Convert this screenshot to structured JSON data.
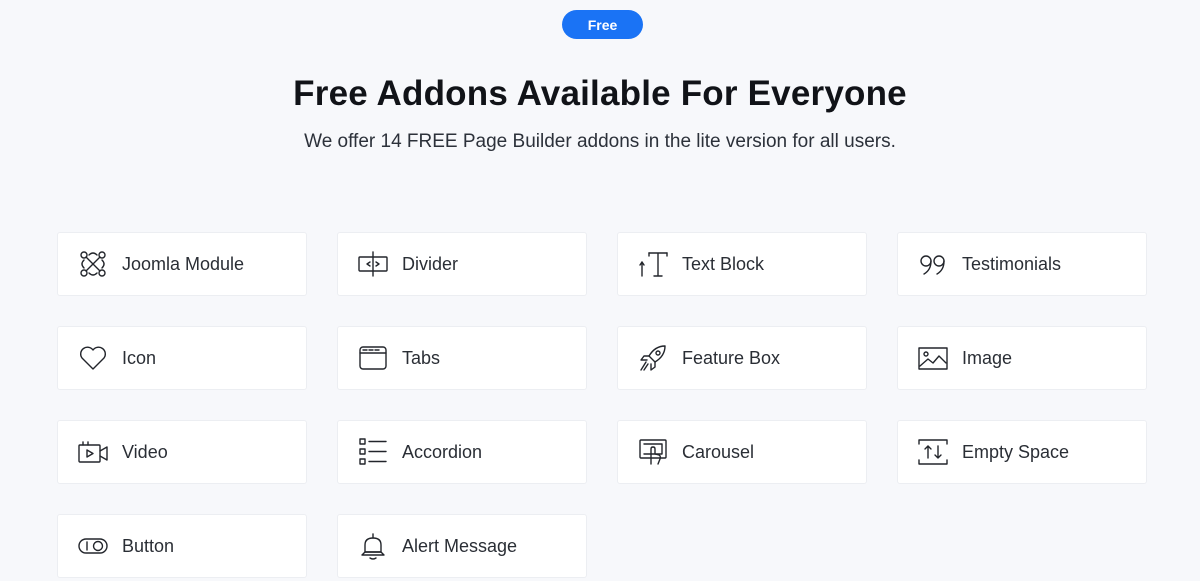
{
  "badge": {
    "label": "Free"
  },
  "header": {
    "title": "Free Addons Available For Everyone",
    "subtitle": "We offer 14 FREE Page Builder addons in the lite version for all users."
  },
  "addons": [
    {
      "label": "Joomla Module",
      "icon": "joomla-icon"
    },
    {
      "label": "Divider",
      "icon": "divider-icon"
    },
    {
      "label": "Text Block",
      "icon": "text-block-icon"
    },
    {
      "label": "Testimonials",
      "icon": "quote-icon"
    },
    {
      "label": "Icon",
      "icon": "heart-icon"
    },
    {
      "label": "Tabs",
      "icon": "tabs-icon"
    },
    {
      "label": "Feature Box",
      "icon": "rocket-icon"
    },
    {
      "label": "Image",
      "icon": "image-icon"
    },
    {
      "label": "Video",
      "icon": "video-icon"
    },
    {
      "label": "Accordion",
      "icon": "accordion-icon"
    },
    {
      "label": "Carousel",
      "icon": "carousel-icon"
    },
    {
      "label": "Empty Space",
      "icon": "empty-space-icon"
    },
    {
      "label": "Button",
      "icon": "toggle-button-icon"
    },
    {
      "label": "Alert Message",
      "icon": "bell-icon"
    }
  ],
  "colors": {
    "accent": "#1a73f5",
    "background": "#f7f8fb",
    "card": "#ffffff",
    "text": "#111318"
  }
}
